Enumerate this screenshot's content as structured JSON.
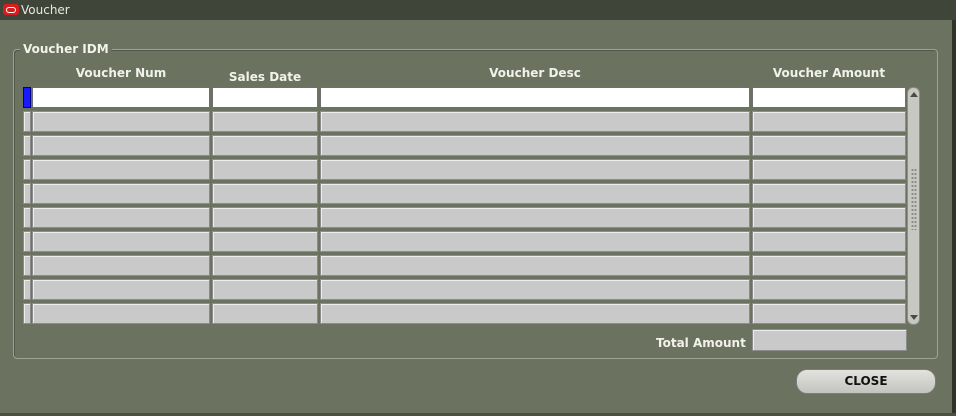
{
  "window": {
    "title": "Voucher"
  },
  "group": {
    "label": "Voucher IDM"
  },
  "columns": {
    "voucher_num": "Voucher Num",
    "sales_date": "Sales Date",
    "voucher_desc": "Voucher Desc",
    "voucher_amount": "Voucher Amount"
  },
  "rows": [
    {
      "voucher_num": "",
      "sales_date": "",
      "voucher_desc": "",
      "voucher_amount": "",
      "active": true
    },
    {
      "voucher_num": "",
      "sales_date": "",
      "voucher_desc": "",
      "voucher_amount": ""
    },
    {
      "voucher_num": "",
      "sales_date": "",
      "voucher_desc": "",
      "voucher_amount": ""
    },
    {
      "voucher_num": "",
      "sales_date": "",
      "voucher_desc": "",
      "voucher_amount": ""
    },
    {
      "voucher_num": "",
      "sales_date": "",
      "voucher_desc": "",
      "voucher_amount": ""
    },
    {
      "voucher_num": "",
      "sales_date": "",
      "voucher_desc": "",
      "voucher_amount": ""
    },
    {
      "voucher_num": "",
      "sales_date": "",
      "voucher_desc": "",
      "voucher_amount": ""
    },
    {
      "voucher_num": "",
      "sales_date": "",
      "voucher_desc": "",
      "voucher_amount": ""
    },
    {
      "voucher_num": "",
      "sales_date": "",
      "voucher_desc": "",
      "voucher_amount": ""
    },
    {
      "voucher_num": "",
      "sales_date": "",
      "voucher_desc": "",
      "voucher_amount": ""
    }
  ],
  "totals": {
    "label": "Total Amount",
    "value": ""
  },
  "buttons": {
    "close_label": "CLOSE"
  },
  "icons": {
    "window_icon": "oracle-logo-icon"
  },
  "colors": {
    "background": "#6b7260",
    "titlebar": "#3f4538",
    "field": "#c9c9c9",
    "current_record": "#1a1aff"
  }
}
